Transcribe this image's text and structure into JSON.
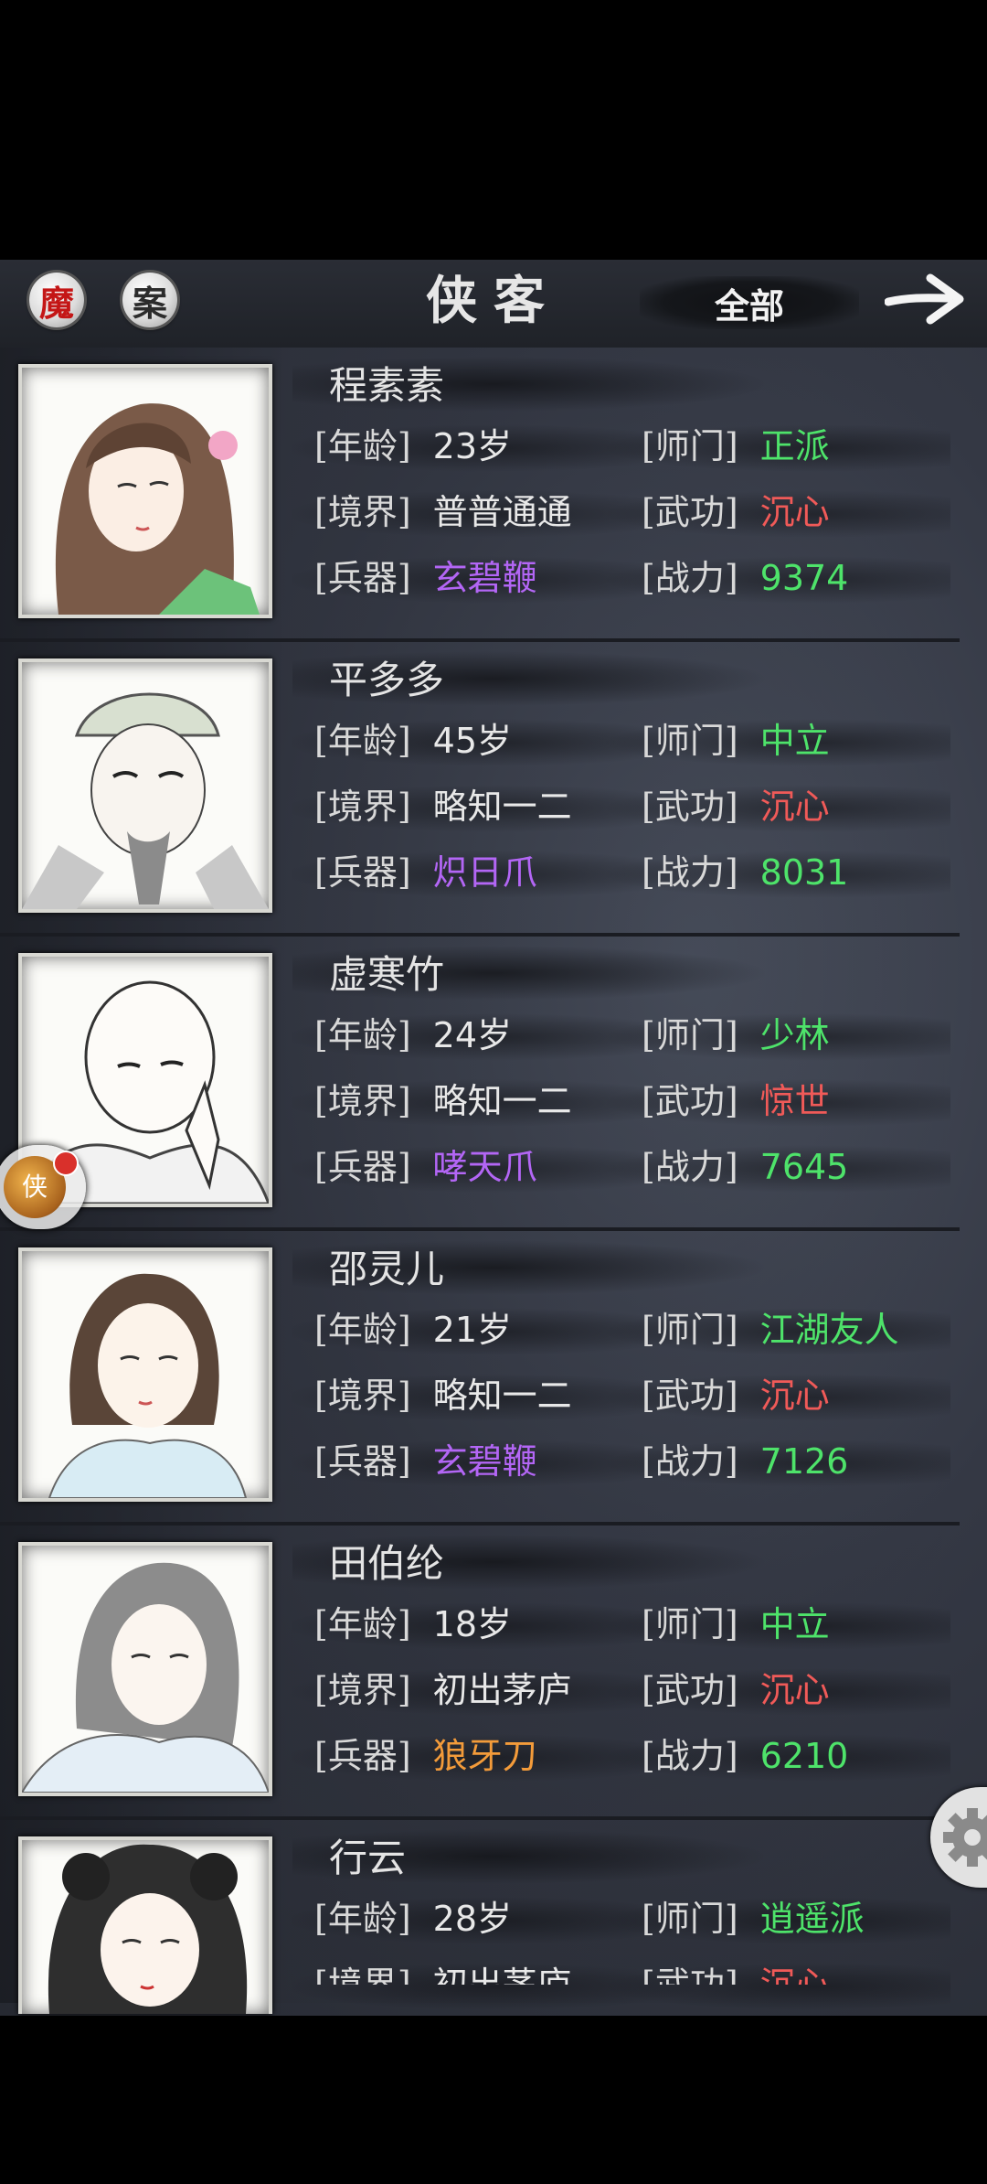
{
  "header": {
    "btn_mo": "魔",
    "btn_an": "案",
    "title": "侠客",
    "filter": "全部"
  },
  "labels": {
    "age": "[年龄]",
    "sect": "[师门]",
    "realm": "[境界]",
    "skill": "[武功]",
    "weapon": "[兵器]",
    "power": "[战力]"
  },
  "float_badge": "侠",
  "heroes": [
    {
      "name": "程素素",
      "age": "23岁",
      "sect": "正派",
      "realm": "普普通通",
      "skill": "沉心",
      "weapon": "玄碧鞭",
      "power": "9374",
      "weapon_color": "#b366f5",
      "skill_color": "#f05a58"
    },
    {
      "name": "平多多",
      "age": "45岁",
      "sect": "中立",
      "realm": "略知一二",
      "skill": "沉心",
      "weapon": "炽日爪",
      "power": "8031",
      "weapon_color": "#b366f5",
      "skill_color": "#f05a58"
    },
    {
      "name": "虚寒竹",
      "age": "24岁",
      "sect": "少林",
      "realm": "略知一二",
      "skill": "惊世",
      "weapon": "哮天爪",
      "power": "7645",
      "weapon_color": "#b366f5",
      "skill_color": "#f05a58"
    },
    {
      "name": "邵灵儿",
      "age": "21岁",
      "sect": "江湖友人",
      "realm": "略知一二",
      "skill": "沉心",
      "weapon": "玄碧鞭",
      "power": "7126",
      "weapon_color": "#b366f5",
      "skill_color": "#f05a58"
    },
    {
      "name": "田伯纶",
      "age": "18岁",
      "sect": "中立",
      "realm": "初出茅庐",
      "skill": "沉心",
      "weapon": "狼牙刀",
      "power": "6210",
      "weapon_color": "#f39b3a",
      "skill_color": "#f05a58"
    },
    {
      "name": "行云",
      "age": "28岁",
      "sect": "逍遥派",
      "realm": "初出茅庐",
      "skill": "沉心",
      "weapon": "",
      "power": "",
      "weapon_color": "#b366f5",
      "skill_color": "#f05a58"
    }
  ]
}
